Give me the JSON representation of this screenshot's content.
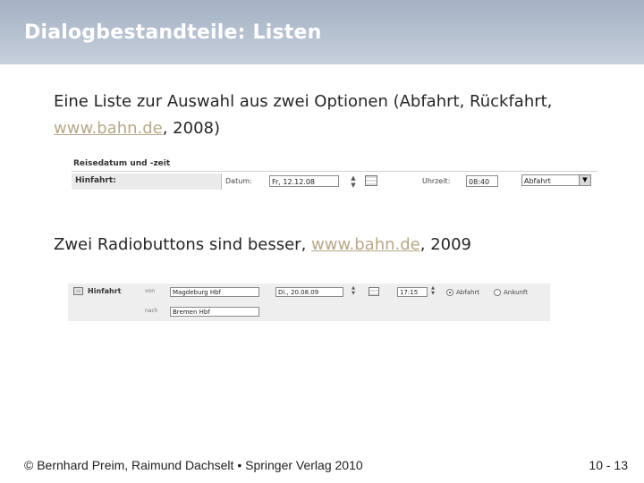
{
  "slide": {
    "title": "Dialogbestandteile: Listen",
    "p1_text1": "Eine Liste zur Auswahl aus zwei Optionen (Abfahrt, Rückfahrt,",
    "p1_link": "www.bahn.de",
    "p1_text2": ", 2008)",
    "p2_text1": "Zwei Radiobuttons sind besser, ",
    "p2_link": "www.bahn.de",
    "p2_text2": ", 2009"
  },
  "screenshot1": {
    "header": "Reisedatum und -zeit",
    "row_label": "Hinfahrt:",
    "date_label": "Datum:",
    "date_value": "Fr, 12.12.08",
    "time_label": "Uhrzeit:",
    "time_value": "08:40",
    "select_value": "Abfahrt"
  },
  "screenshot2": {
    "title": "Hinfahrt",
    "from_label": "von",
    "to_label": "nach",
    "from_value": "Magdeburg Hbf",
    "to_value": "Bremen Hbf",
    "date_value": "Di., 20.08.09",
    "time_value": "17:15",
    "radio1": "Abfahrt",
    "radio2": "Ankunft"
  },
  "footer": {
    "credit_left": "© Bernhard Preim, Raimund Dachselt",
    "bullet": "•",
    "credit_right": "Springer Verlag 2010",
    "page": "10 - 13"
  },
  "colors": {
    "title_bar": "#a3b1c3",
    "link": "#b7a887"
  }
}
